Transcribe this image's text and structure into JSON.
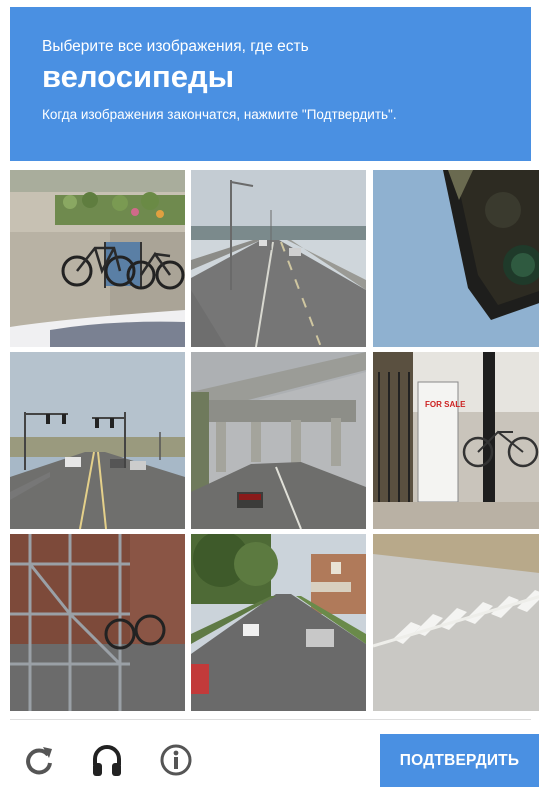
{
  "header": {
    "line1": "Выберите все изображения, где есть",
    "keyword": "велосипеды",
    "line3": "Когда изображения закончатся, нажмите \"Подтвердить\"."
  },
  "tiles": [
    {
      "row": 1,
      "col": 1,
      "scene": "bicycles-parked-sidewalk"
    },
    {
      "row": 1,
      "col": 2,
      "scene": "bridge-road"
    },
    {
      "row": 1,
      "col": 3,
      "scene": "traffic-light-sky"
    },
    {
      "row": 2,
      "col": 1,
      "scene": "road-traffic-lights"
    },
    {
      "row": 2,
      "col": 2,
      "scene": "highway-overpass"
    },
    {
      "row": 2,
      "col": 3,
      "scene": "for-sale-sign-bicycle"
    },
    {
      "row": 3,
      "col": 1,
      "scene": "scaffolding-bicycle"
    },
    {
      "row": 3,
      "col": 2,
      "scene": "residential-street"
    },
    {
      "row": 3,
      "col": 3,
      "scene": "crosswalk-asphalt"
    }
  ],
  "sign_text": "FOR SALE",
  "footer": {
    "reload_icon": "reload-icon",
    "audio_icon": "headphones-icon",
    "info_icon": "info-icon",
    "verify_label": "ПОДТВЕРДИТЬ"
  },
  "colors": {
    "accent": "#4a90e2",
    "icon": "#555555"
  }
}
